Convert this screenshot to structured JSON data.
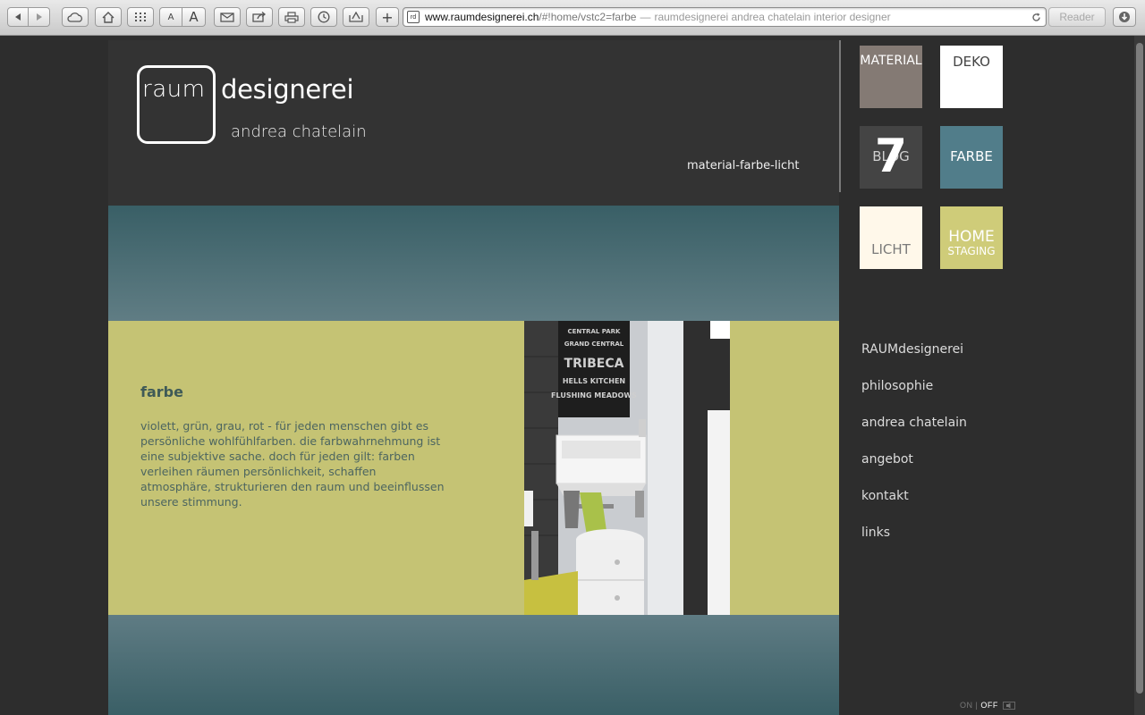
{
  "browser": {
    "url_host": "www.raumdesignerei.ch",
    "url_path": "/#!home/vstc2=farbe",
    "url_separator": "—",
    "page_title": "raumdesignerei andrea chatelain interior designer",
    "favicon_text": "rd",
    "reader_label": "Reader",
    "font_small_label": "A",
    "font_large_label": "A",
    "new_tab_label": "+"
  },
  "header": {
    "logo_raum": "raum",
    "logo_designerei": "designerei",
    "logo_subtitle": "andrea chatelain",
    "tagline": "material-farbe-licht"
  },
  "tiles": [
    {
      "label": "MATERIAL",
      "color": "#847a74",
      "text_color": "#ffffff"
    },
    {
      "label": "DEKO",
      "color": "#ffffff",
      "text_color": "#444444"
    },
    {
      "label": "BLOG",
      "number": "7",
      "color": "#444444",
      "text_color": "#cfcfcf"
    },
    {
      "label": "FARBE",
      "color": "#517d8a",
      "text_color": "#ffffff"
    },
    {
      "label": "LICHT",
      "color": "#fff8ea",
      "text_color": "#7a7a7a"
    },
    {
      "label": "HOME",
      "sublabel": "STAGING",
      "color": "#cfcc79",
      "text_color": "#ffffff"
    }
  ],
  "content": {
    "heading": "farbe",
    "body": "violett, grün, grau, rot - für jeden menschen gibt es persönliche wohlfühlfarben. die farbwahrnehmung ist eine subjektive sache. doch für jeden gilt: farben verleihen räumen persönlichkeit, schaffen atmosphäre, strukturieren den raum und beeinflussen unsere stimmung."
  },
  "photo": {
    "poster_lines": [
      "CENTRAL PARK",
      "GRAND CENTRAL",
      "TRIBECA",
      "HELLS KITCHEN",
      "FLUSHING MEADOWS"
    ]
  },
  "nav": {
    "items": [
      "RAUMdesignerei",
      "philosophie",
      "andrea chatelain",
      "angebot",
      "kontakt",
      "links"
    ]
  },
  "sound": {
    "on_label": "ON",
    "separator": "|",
    "off_label": "OFF"
  },
  "colors": {
    "band_teal": "#4d6f76",
    "band_olive": "#c5c374",
    "page_bg": "#2d2d2d"
  }
}
